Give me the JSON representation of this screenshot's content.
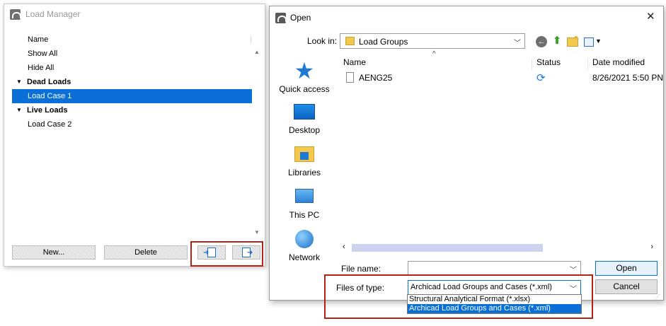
{
  "load_manager": {
    "title": "Load Manager",
    "column_header": "Name",
    "items": [
      {
        "label": "Show All",
        "kind": "action"
      },
      {
        "label": "Hide All",
        "kind": "action"
      },
      {
        "label": "Dead Loads",
        "kind": "group"
      },
      {
        "label": "Load Case 1",
        "kind": "case",
        "selected": true
      },
      {
        "label": "Live Loads",
        "kind": "group"
      },
      {
        "label": "Load Case 2",
        "kind": "case"
      }
    ],
    "buttons": {
      "new": "New...",
      "delete": "Delete"
    },
    "icons": {
      "import": "import-file-icon",
      "export": "export-file-icon"
    },
    "highlight_color": "#b42318"
  },
  "open_dialog": {
    "title": "Open",
    "look_in_label": "Look in:",
    "look_in_value": "Load Groups",
    "places": [
      "Quick access",
      "Desktop",
      "Libraries",
      "This PC",
      "Network"
    ],
    "columns": {
      "name": "Name",
      "status": "Status",
      "date": "Date modified"
    },
    "files": [
      {
        "name": "AENG25",
        "status_icon": "sync-icon",
        "date": "8/26/2021 5:50 PN"
      }
    ],
    "file_name_label": "File name:",
    "file_name_value": "",
    "files_of_type_label": "Files of type:",
    "files_of_type_value": "Archicad Load Groups and Cases (*.xml)",
    "file_type_options": [
      "Structural Analytical Format (*.xlsx)",
      "Archicad Load Groups and Cases (*.xml)"
    ],
    "buttons": {
      "open": "Open",
      "cancel": "Cancel"
    },
    "accent": "#0a6fd6"
  }
}
